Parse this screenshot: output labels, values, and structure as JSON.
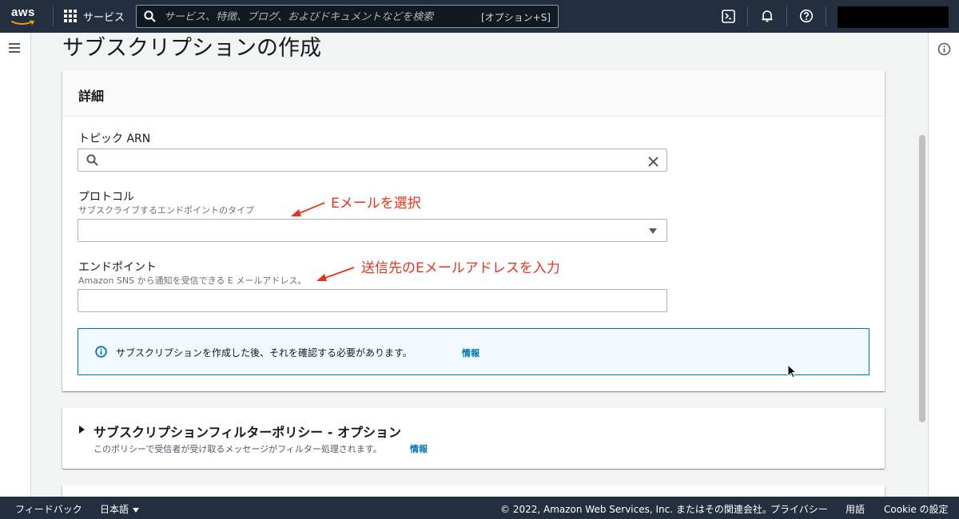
{
  "topnav": {
    "logo_text": "aws",
    "services_label": "サービス",
    "search_placeholder": "サービス、特徴、ブログ、およびドキュメントなどを検索",
    "search_shortcut": "[オプション+S]"
  },
  "page": {
    "title": "サブスクリプションの作成"
  },
  "details": {
    "header": "詳細",
    "topic_arn": {
      "label": "トピック ARN",
      "value": ""
    },
    "protocol": {
      "label": "プロトコル",
      "description": "サブスクライブするエンドポイントのタイプ",
      "value": ""
    },
    "endpoint": {
      "label": "エンドポイント",
      "description": "Amazon SNS から通知を受信できる E メールアドレス。",
      "value": ""
    },
    "alert": {
      "text": "サブスクリプションを作成した後、それを確認する必要があります。",
      "link": "情報"
    }
  },
  "filter_policy": {
    "title": "サブスクリプションフィルターポリシー - オプション",
    "description": "このポリシーで受信者が受け取るメッセージがフィルター処理されます。",
    "link": "情報"
  },
  "annotations": {
    "protocol_note": "Eメールを選択",
    "endpoint_note": "送信先のEメールアドレスを入力",
    "color": "#e8331c"
  },
  "footer": {
    "feedback": "フィードバック",
    "language": "日本語",
    "copyright": "© 2022, Amazon Web Services, Inc. またはその関連会社。",
    "privacy": "プライバシー",
    "terms": "用語",
    "cookie": "Cookie の設定"
  },
  "colors": {
    "nav_bg": "#232f3e",
    "link": "#0073bb",
    "alert_bg": "#f1faff"
  }
}
